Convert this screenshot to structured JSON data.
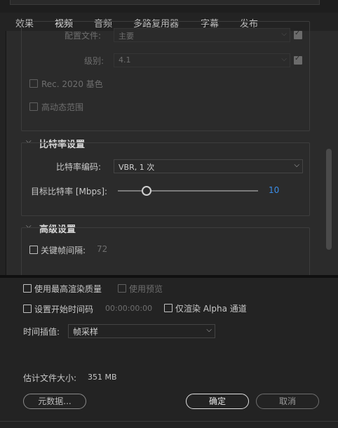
{
  "tabs": [
    {
      "label": "效果",
      "active": false
    },
    {
      "label": "视频",
      "active": true
    },
    {
      "label": "音频",
      "active": false
    },
    {
      "label": "多路复用器",
      "active": false
    },
    {
      "label": "字幕",
      "active": false
    },
    {
      "label": "发布",
      "active": false
    }
  ],
  "video": {
    "profile_label": "配置文件:",
    "profile_value": "主要",
    "level_label": "级别:",
    "level_value": "4.1",
    "rec2020_label": "Rec. 2020 基色",
    "hdr_label": "高动态范围"
  },
  "bitrate": {
    "section_title": "比特率设置",
    "encoding_label": "比特率编码:",
    "encoding_value": "VBR, 1 次",
    "target_label": "目标比特率 [Mbps]:",
    "target_value": "10",
    "target_fraction": 0.2
  },
  "advanced": {
    "section_title": "高级设置",
    "keyframe_label": "关键帧间隔:",
    "keyframe_value": "72"
  },
  "options": {
    "max_render_quality": "使用最高渲染质量",
    "use_previews": "使用预览",
    "set_start_timecode": "设置开始时间码",
    "start_timecode_value": "00:00:00:00",
    "render_alpha_only": "仅渲染 Alpha 通道",
    "time_interp_label": "时间插值:",
    "time_interp_value": "帧采样"
  },
  "estimated": {
    "label": "估计文件大小:",
    "value": "351 MB"
  },
  "buttons": {
    "metadata": "元数据...",
    "ok": "确定",
    "cancel": "取消"
  },
  "colors": {
    "accent_value": "#3b8ee8",
    "background": "#232323",
    "panel": "#2b2b2b"
  }
}
